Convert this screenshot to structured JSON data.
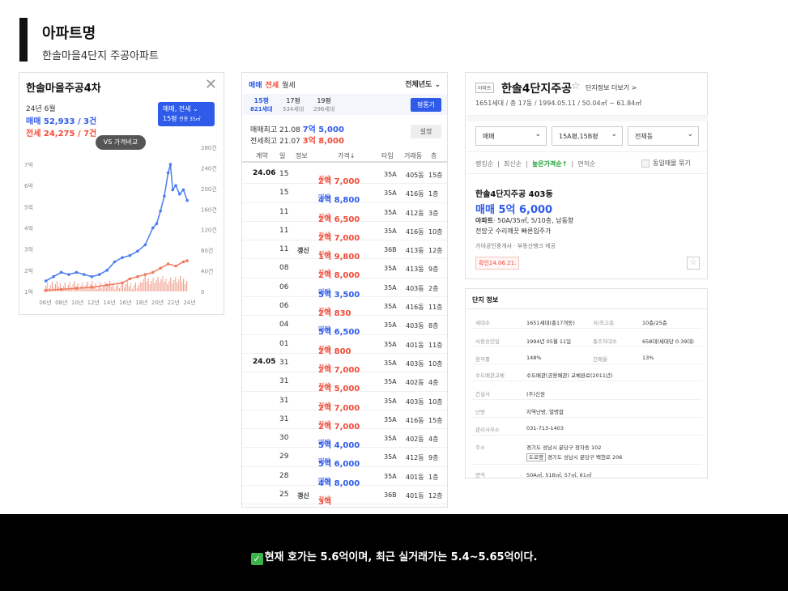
{
  "header": {
    "title": "아파트명",
    "subtitle": "한솔마을4단지 주공아파트"
  },
  "panel1": {
    "title": "한솔마을주공4차",
    "month": "24년 6월",
    "sale": "매매 52,933 / 3건",
    "jeonse": "전세 24,275 / 7건",
    "pill_line1": "매매, 전세",
    "pill_line2": "15평",
    "pill_note": "전용 35㎡",
    "vs_label": "VS 가격비교",
    "chart_data": {
      "type": "line",
      "title": "",
      "x_ticks": [
        "06년",
        "08년",
        "10년",
        "12년",
        "14년",
        "16년",
        "18년",
        "20년",
        "22년",
        "24년"
      ],
      "y_left_ticks": [
        "1억",
        "2억",
        "3억",
        "4억",
        "5억",
        "6억",
        "7억"
      ],
      "y_right_ticks": [
        "0",
        "40건",
        "80건",
        "120건",
        "160건",
        "200건",
        "240건",
        "280건"
      ],
      "ylim_left": [
        1,
        7.5
      ],
      "series": [
        {
          "color": "#4a7cf0",
          "x": [
            2006,
            2007,
            2008,
            2009,
            2010,
            2011,
            2012,
            2013,
            2014,
            2015,
            2016,
            2017,
            2018,
            2019,
            2020,
            2020.5,
            2021,
            2021.5,
            2022,
            2022.3,
            2022.6,
            2023,
            2023.5,
            2024,
            2024.5
          ],
          "values": [
            1.5,
            1.7,
            1.9,
            1.8,
            1.9,
            1.8,
            1.7,
            1.8,
            2.0,
            2.4,
            2.6,
            2.7,
            2.9,
            3.2,
            4.0,
            4.2,
            4.8,
            5.5,
            6.6,
            7.0,
            5.8,
            6.0,
            5.6,
            5.8,
            5.3
          ]
        },
        {
          "color": "#f07a5f",
          "x": [
            2006,
            2008,
            2010,
            2012,
            2014,
            2016,
            2017,
            2018,
            2019,
            2020,
            2021,
            2022,
            2023,
            2024,
            2024.5
          ],
          "values": [
            1.05,
            1.1,
            1.15,
            1.2,
            1.3,
            1.4,
            1.6,
            1.7,
            1.8,
            1.9,
            2.1,
            2.3,
            2.2,
            2.4,
            2.45
          ]
        }
      ],
      "grid": false
    }
  },
  "panel2": {
    "tabs": [
      "매매",
      "전세",
      "월세"
    ],
    "year": "전체년도",
    "sizes": [
      {
        "label": "15평",
        "count": "821세대"
      },
      {
        "label": "17평",
        "count": "534세대"
      },
      {
        "label": "19평",
        "count": "296세대"
      }
    ],
    "size_btn": "평통기",
    "hi_sale_label": "매매최고",
    "hi_sale_date": "21.08",
    "hi_sale_price": "7억 5,000",
    "hi_jeon_label": "전세최고",
    "hi_jeon_date": "21.07",
    "hi_jeon_price": "3억 8,000",
    "gray_btn": "설정",
    "cols": [
      "계약",
      "일",
      "정보",
      "가격↓",
      "타입",
      "거래동",
      "층"
    ],
    "rows": [
      {
        "ym": "24.06",
        "d": "15",
        "inf": "",
        "kind": "전세",
        "price": "2억 7,000",
        "ty": "35A",
        "dg": "405동",
        "fl": "15층",
        "c": "r"
      },
      {
        "ym": "",
        "d": "15",
        "inf": "",
        "kind": "매매",
        "price": "4억 8,800",
        "ty": "35A",
        "dg": "416동",
        "fl": "1층",
        "c": "b"
      },
      {
        "ym": "",
        "d": "11",
        "inf": "",
        "kind": "전세",
        "price": "2억 6,500",
        "ty": "35A",
        "dg": "412동",
        "fl": "3층",
        "c": "r"
      },
      {
        "ym": "",
        "d": "11",
        "inf": "",
        "kind": "전세",
        "price": "2억 7,000",
        "ty": "35A",
        "dg": "416동",
        "fl": "10층",
        "c": "r"
      },
      {
        "ym": "",
        "d": "11",
        "inf": "갱신",
        "kind": "전세",
        "price": "1억 9,800",
        "ty": "36B",
        "dg": "413동",
        "fl": "12층",
        "c": "r"
      },
      {
        "ym": "",
        "d": "08",
        "inf": "",
        "kind": "전세",
        "price": "2억 8,000",
        "ty": "35A",
        "dg": "413동",
        "fl": "9층",
        "c": "r"
      },
      {
        "ym": "",
        "d": "06",
        "inf": "",
        "kind": "매매",
        "price": "5억 3,500",
        "ty": "35A",
        "dg": "403동",
        "fl": "2층",
        "c": "b"
      },
      {
        "ym": "",
        "d": "06",
        "inf": "",
        "kind": "전세",
        "price": "2억 830",
        "ty": "35A",
        "dg": "416동",
        "fl": "11층",
        "c": "r"
      },
      {
        "ym": "",
        "d": "04",
        "inf": "",
        "kind": "매매",
        "price": "5억 6,500",
        "ty": "35A",
        "dg": "403동",
        "fl": "8층",
        "c": "b"
      },
      {
        "ym": "",
        "d": "01",
        "inf": "",
        "kind": "전세",
        "price": "2억 800",
        "ty": "35A",
        "dg": "401동",
        "fl": "11층",
        "c": "r"
      },
      {
        "ym": "24.05",
        "d": "31",
        "inf": "",
        "kind": "전세",
        "price": "2억 7,000",
        "ty": "35A",
        "dg": "403동",
        "fl": "10층",
        "c": "r"
      },
      {
        "ym": "",
        "d": "31",
        "inf": "",
        "kind": "전세",
        "price": "2억 5,000",
        "ty": "35A",
        "dg": "402동",
        "fl": "4층",
        "c": "r"
      },
      {
        "ym": "",
        "d": "31",
        "inf": "",
        "kind": "전세",
        "price": "2억 7,000",
        "ty": "35A",
        "dg": "403동",
        "fl": "10층",
        "c": "r"
      },
      {
        "ym": "",
        "d": "31",
        "inf": "",
        "kind": "전세",
        "price": "2억 7,000",
        "ty": "35A",
        "dg": "416동",
        "fl": "15층",
        "c": "r"
      },
      {
        "ym": "",
        "d": "30",
        "inf": "",
        "kind": "매매",
        "price": "5억 4,000",
        "ty": "35A",
        "dg": "402동",
        "fl": "4층",
        "c": "b"
      },
      {
        "ym": "",
        "d": "29",
        "inf": "",
        "kind": "매매",
        "price": "5억 6,000",
        "ty": "35A",
        "dg": "412동",
        "fl": "9층",
        "c": "b"
      },
      {
        "ym": "",
        "d": "28",
        "inf": "",
        "kind": "매매",
        "price": "4억 8,000",
        "ty": "35A",
        "dg": "401동",
        "fl": "1층",
        "c": "b"
      },
      {
        "ym": "",
        "d": "25",
        "inf": "갱신",
        "kind": "전세",
        "price": "3억",
        "ty": "36B",
        "dg": "401동",
        "fl": "12층",
        "c": "r"
      }
    ]
  },
  "panel3": {
    "badge": "아파트",
    "title": "한솔4단지주공",
    "more": "단지정보 더보기 >",
    "sub": "1651세대 / 총 17동 / 1994.05.11 / 50.04㎡ ~ 61.84㎡",
    "selects": [
      "매매",
      "15A평,15B평",
      "전체동"
    ],
    "sorts": [
      "랭킹순",
      "최신순",
      "높은가격순↑",
      "면적순"
    ],
    "same_listing": "동일매물 묶기",
    "listing_name": "한솔4단지주공 403동",
    "listing_price": "매매 5억 6,000",
    "listing_type": "아파트",
    "listing_desc": "· 50A/35㎡, 5/10층, 남동향",
    "listing_desc2": "전망굿 수리깨끗 빠른입주가",
    "agent": "가야공인중개사 · 부동산뱅크 제공",
    "confirm": "확인24.06.21."
  },
  "panel4": {
    "title": "단지 정보",
    "rows": [
      {
        "k": "세대수",
        "v": "1651세대(총17개동)",
        "k2": "저/최고층",
        "v2": "10층/25층"
      },
      {
        "k": "사용승인일",
        "v": "1994년 05월 11일",
        "k2": "총주차대수",
        "v2": "658대(세대당 0.39대)"
      },
      {
        "k": "용적률",
        "v": "148%",
        "k2": "건폐율",
        "v2": "13%"
      },
      {
        "k": "수도배관교체",
        "v": "수도배관(공용배관) 교체완료(2011년)"
      },
      {
        "k": "건설사",
        "v": "(주)신원"
      },
      {
        "k": "난방",
        "v": "지역난방, 열병합"
      },
      {
        "k": "관리사무소",
        "v": "031-713-1403"
      },
      {
        "k": "주소",
        "v": "경기도 성남시 분당구 정자동 102",
        "tag": "도로명",
        "v3": "경기도 성남시 분당구 백현로 206"
      },
      {
        "k": "면적",
        "v": "50A㎡, 51B㎡, 57㎡, 61㎡"
      }
    ]
  },
  "bottom": {
    "check": "✓",
    "text": "현재 호가는 5.6억이며, 최근 실거래가는 5.4~5.65억이다."
  }
}
